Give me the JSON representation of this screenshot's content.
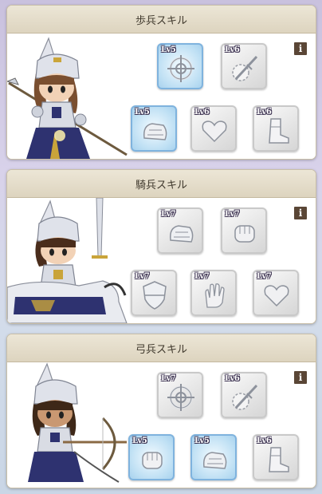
{
  "panels": [
    {
      "title": "歩兵スキル",
      "info_icon": "info-icon",
      "info_label": "i",
      "skills_top": [
        {
          "level": "Lv5",
          "icon": "crosshair-icon",
          "active": true
        },
        {
          "level": "Lv6",
          "icon": "sword-burst-icon",
          "active": false
        }
      ],
      "skills_bottom": [
        {
          "level": "Lv5",
          "icon": "gauntlet-icon",
          "active": true
        },
        {
          "level": "Lv6",
          "icon": "heart-icon",
          "active": false
        },
        {
          "level": "Lv6",
          "icon": "boot-icon",
          "active": false
        }
      ]
    },
    {
      "title": "騎兵スキル",
      "info_icon": "info-icon",
      "info_label": "i",
      "skills_top": [
        {
          "level": "Lv7",
          "icon": "gauntlet-icon",
          "active": false
        },
        {
          "level": "Lv7",
          "icon": "fist-icon",
          "active": false
        }
      ],
      "skills_bottom": [
        {
          "level": "Lv7",
          "icon": "shield-icon",
          "active": false
        },
        {
          "level": "Lv7",
          "icon": "open-hand-icon",
          "active": false
        },
        {
          "level": "Lv7",
          "icon": "heart-icon",
          "active": false
        }
      ]
    },
    {
      "title": "弓兵スキル",
      "info_icon": "info-icon",
      "info_label": "i",
      "skills_top": [
        {
          "level": "Lv7",
          "icon": "crosshair-icon",
          "active": false
        },
        {
          "level": "Lv6",
          "icon": "sword-burst-icon",
          "active": false
        }
      ],
      "skills_bottom": [
        {
          "level": "Lv5",
          "icon": "fist-icon",
          "active": true
        },
        {
          "level": "Lv5",
          "icon": "gauntlet-icon",
          "active": true
        },
        {
          "level": "Lv6",
          "icon": "boot-icon",
          "active": false
        }
      ]
    }
  ],
  "colors": {
    "active_border": "#7fb3de",
    "header_bg": "#ddd4bf",
    "info_bg": "#5a4636",
    "armor_accent": "#2e3270"
  }
}
